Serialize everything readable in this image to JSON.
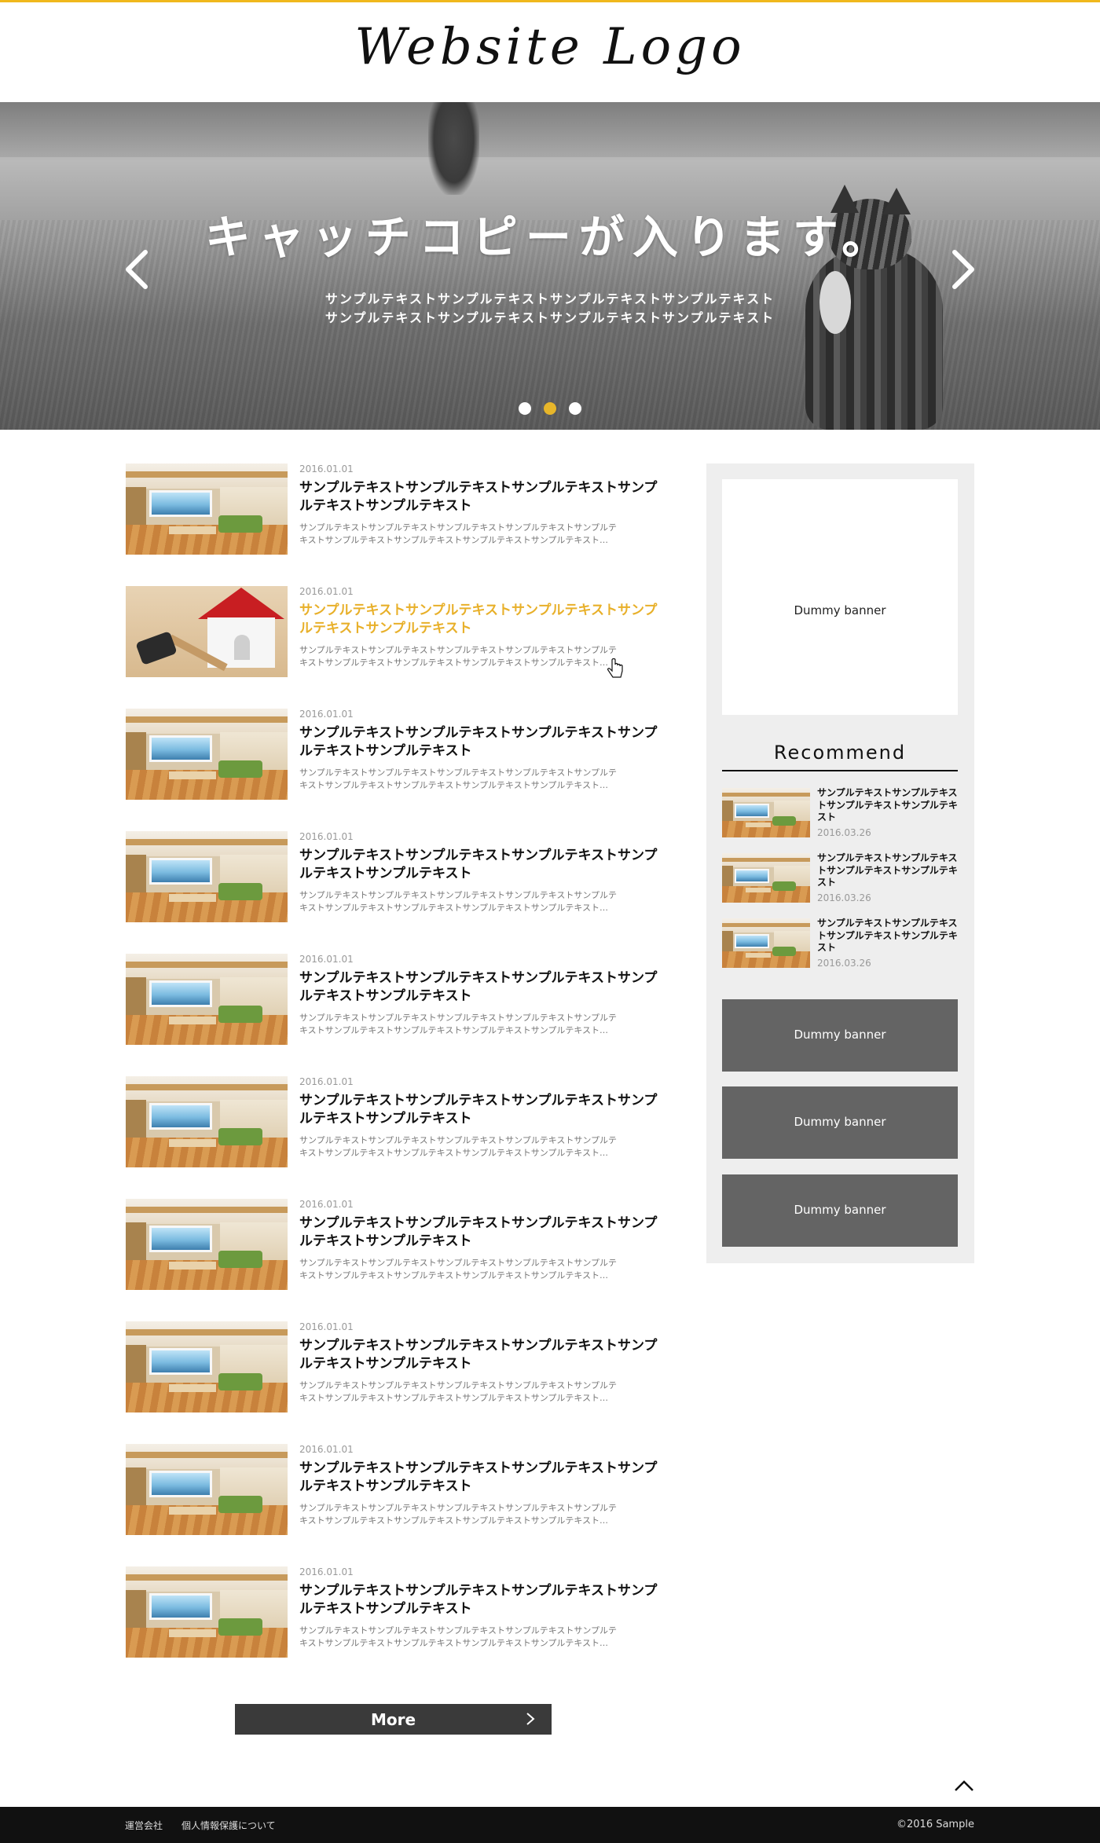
{
  "header": {
    "logo": "Website Logo",
    "accent_color": "#f0b81c"
  },
  "hero": {
    "catch_copy": "キャッチコピーが入ります。",
    "sub_line1": "サンプルテキストサンプルテキストサンプルテキストサンプルテキスト",
    "sub_line2": "サンプルテキストサンプルテキストサンプルテキストサンプルテキスト",
    "prev_icon": "chevron-left-icon",
    "next_icon": "chevron-right-icon",
    "slides": 3,
    "active_slide": 2,
    "active_dot_color": "#e7b62a"
  },
  "posts": [
    {
      "date": "2016.01.01",
      "title": "サンプルテキストサンプルテキストサンプルテキストサンプルテキストサンプルテキスト",
      "excerpt1": "サンプルテキストサンプルテキストサンプルテキストサンプルテキストサンプルテ",
      "excerpt2": "キストサンプルテキストサンプルテキストサンプルテキストサンプルテキスト…",
      "highlighted": false
    },
    {
      "date": "2016.01.01",
      "title": "サンプルテキストサンプルテキストサンプルテキストサンプルテキストサンプルテキスト",
      "excerpt1": "サンプルテキストサンプルテキストサンプルテキストサンプルテキストサンプルテ",
      "excerpt2": "キストサンプルテキストサンプルテキストサンプルテキストサンプルテキスト…",
      "highlighted": true
    },
    {
      "date": "2016.01.01",
      "title": "サンプルテキストサンプルテキストサンプルテキストサンプルテキストサンプルテキスト",
      "excerpt1": "サンプルテキストサンプルテキストサンプルテキストサンプルテキストサンプルテ",
      "excerpt2": "キストサンプルテキストサンプルテキストサンプルテキストサンプルテキスト…",
      "highlighted": false
    },
    {
      "date": "2016.01.01",
      "title": "サンプルテキストサンプルテキストサンプルテキストサンプルテキストサンプルテキスト",
      "excerpt1": "サンプルテキストサンプルテキストサンプルテキストサンプルテキストサンプルテ",
      "excerpt2": "キストサンプルテキストサンプルテキストサンプルテキストサンプルテキスト…",
      "highlighted": false
    },
    {
      "date": "2016.01.01",
      "title": "サンプルテキストサンプルテキストサンプルテキストサンプルテキストサンプルテキスト",
      "excerpt1": "サンプルテキストサンプルテキストサンプルテキストサンプルテキストサンプルテ",
      "excerpt2": "キストサンプルテキストサンプルテキストサンプルテキストサンプルテキスト…",
      "highlighted": false
    },
    {
      "date": "2016.01.01",
      "title": "サンプルテキストサンプルテキストサンプルテキストサンプルテキストサンプルテキスト",
      "excerpt1": "サンプルテキストサンプルテキストサンプルテキストサンプルテキストサンプルテ",
      "excerpt2": "キストサンプルテキストサンプルテキストサンプルテキストサンプルテキスト…",
      "highlighted": false
    },
    {
      "date": "2016.01.01",
      "title": "サンプルテキストサンプルテキストサンプルテキストサンプルテキストサンプルテキスト",
      "excerpt1": "サンプルテキストサンプルテキストサンプルテキストサンプルテキストサンプルテ",
      "excerpt2": "キストサンプルテキストサンプルテキストサンプルテキストサンプルテキスト…",
      "highlighted": false
    },
    {
      "date": "2016.01.01",
      "title": "サンプルテキストサンプルテキストサンプルテキストサンプルテキストサンプルテキスト",
      "excerpt1": "サンプルテキストサンプルテキストサンプルテキストサンプルテキストサンプルテ",
      "excerpt2": "キストサンプルテキストサンプルテキストサンプルテキストサンプルテキスト…",
      "highlighted": false
    },
    {
      "date": "2016.01.01",
      "title": "サンプルテキストサンプルテキストサンプルテキストサンプルテキストサンプルテキスト",
      "excerpt1": "サンプルテキストサンプルテキストサンプルテキストサンプルテキストサンプルテ",
      "excerpt2": "キストサンプルテキストサンプルテキストサンプルテキストサンプルテキスト…",
      "highlighted": false
    },
    {
      "date": "2016.01.01",
      "title": "サンプルテキストサンプルテキストサンプルテキストサンプルテキストサンプルテキスト",
      "excerpt1": "サンプルテキストサンプルテキストサンプルテキストサンプルテキストサンプルテ",
      "excerpt2": "キストサンプルテキストサンプルテキストサンプルテキストサンプルテキスト…",
      "highlighted": false
    }
  ],
  "more_button": {
    "label": "More",
    "icon": "chevron-right-icon"
  },
  "sidebar": {
    "top_banner": "Dummy banner",
    "recommend_title": "Recommend",
    "recommend": [
      {
        "title": "サンプルテキストサンプルテキストサンプルテキストサンプルテキスト",
        "date": "2016.03.26"
      },
      {
        "title": "サンプルテキストサンプルテキストサンプルテキストサンプルテキスト",
        "date": "2016.03.26"
      },
      {
        "title": "サンプルテキストサンプルテキストサンプルテキストサンプルテキスト",
        "date": "2016.03.26"
      }
    ],
    "banners": [
      "Dummy banner",
      "Dummy banner",
      "Dummy banner"
    ]
  },
  "page_top_icon": "chevron-up-icon",
  "footer": {
    "links": [
      "運営会社",
      "個人情報保護について"
    ],
    "copyright": "©2016 Sample"
  }
}
